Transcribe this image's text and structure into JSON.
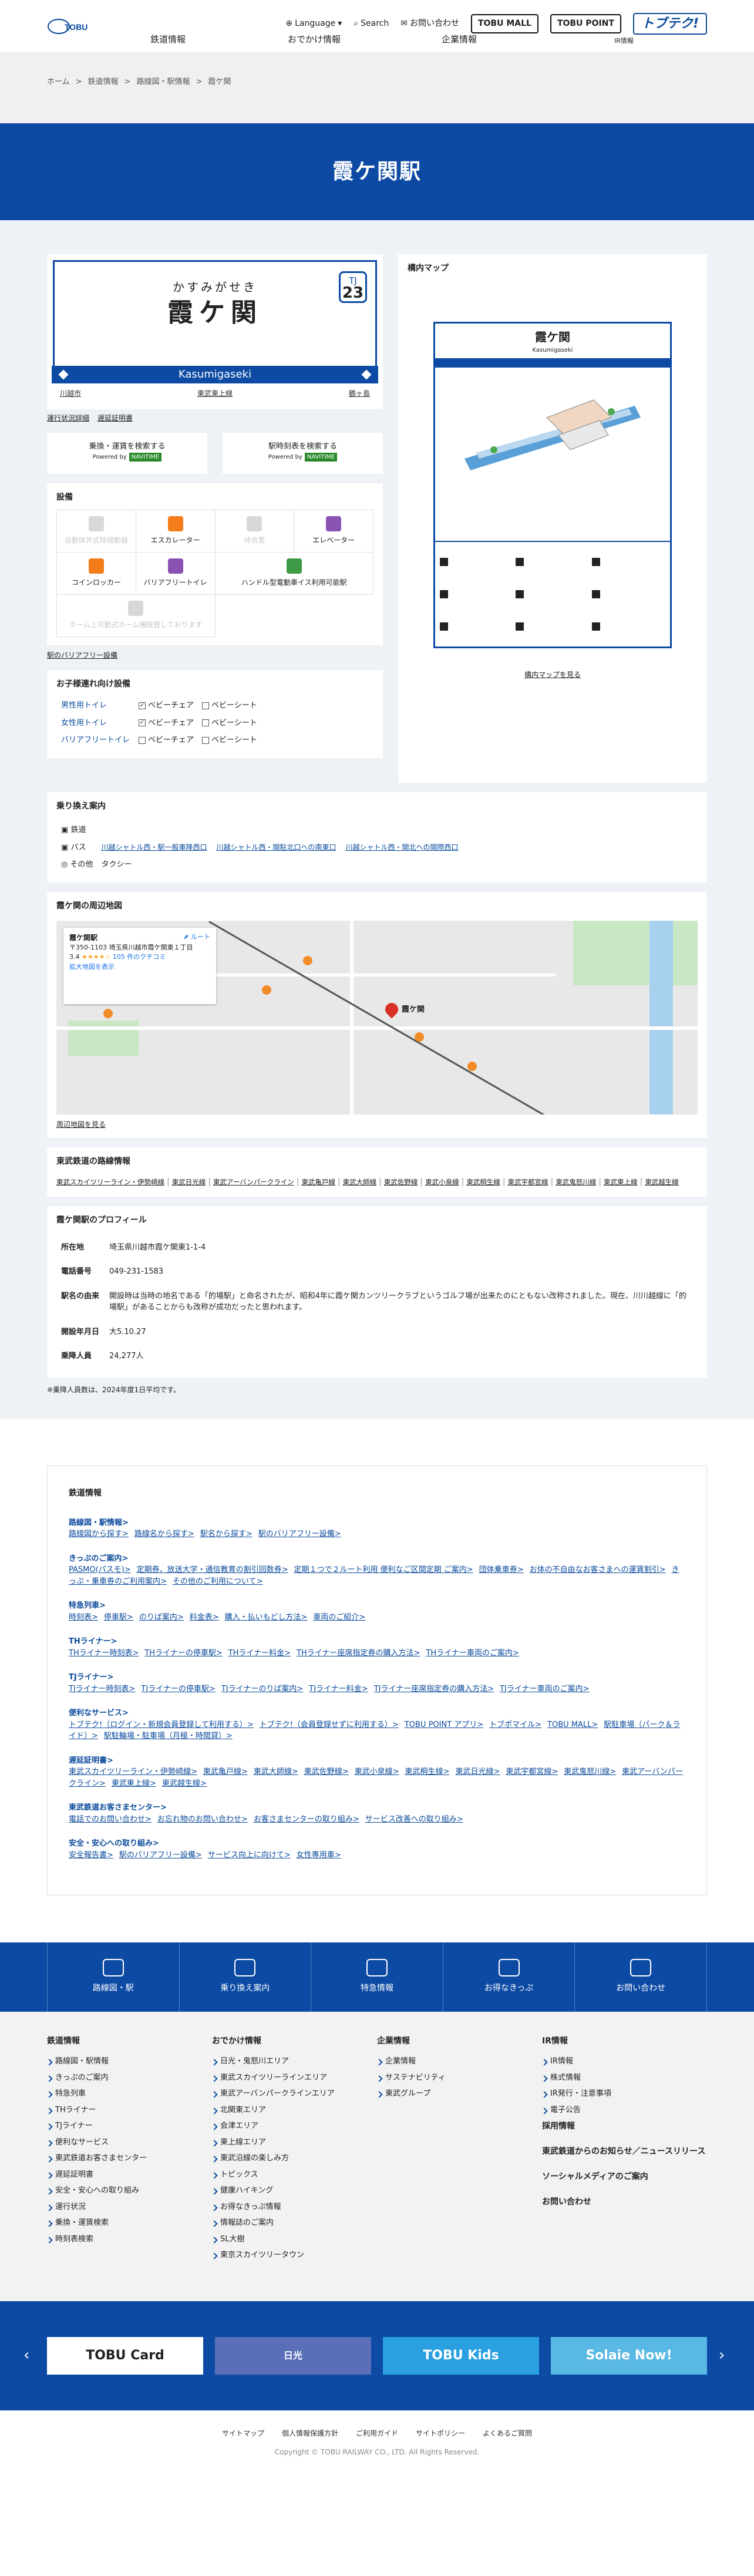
{
  "header": {
    "language": "Language",
    "search": "Search",
    "contact": "お問い合わせ",
    "tobumall": "TOBU MALL",
    "tobupoint": "TOBU POINT",
    "topic": "トブテク!",
    "nav": [
      "鉄道情報",
      "おでかけ情報",
      "企業情報",
      "IR情報"
    ]
  },
  "breadcrumb": [
    "ホーム",
    "鉄道情報",
    "路線図・駅情報",
    "霞ケ関"
  ],
  "hero_title": "霞ケ関駅",
  "sign": {
    "kana": "かすみがせき",
    "kanji": "霞ケ関",
    "roman": "Kasumigaseki",
    "line_code": "TJ",
    "number": "23",
    "prev": "川越市",
    "mid": "東武東上線",
    "next": "鶴ヶ島",
    "link1": "運行状況詳細",
    "link2": "遅延証明書"
  },
  "search_btn1": "乗換・運賃を検索する",
  "search_btn2": "駅時刻表を検索する",
  "powered": "Powered by",
  "navitime": "NAVITIME",
  "facilities": {
    "title": "設備",
    "items": [
      "自動体外式除細動器",
      "エスカレーター",
      "待合室",
      "エレベーター",
      "コインロッカー",
      "バリアフリートイレ",
      "ハンドル型電動車イス利用可能駅"
    ],
    "last": "ホーム上可動式ホーム柵設置しております",
    "link": "駅のバリアフリー設備"
  },
  "child": {
    "title": "お子様連れ向け設備",
    "rows": [
      {
        "name": "男性用トイレ",
        "a": "ベビーチェア",
        "b": "ベビーシート"
      },
      {
        "name": "女性用トイレ",
        "a": "ベビーチェア",
        "b": "ベビーシート"
      },
      {
        "name": "バリアフリートイレ",
        "a": "ベビーチェア",
        "b": "ベビーシート"
      }
    ]
  },
  "floormap": {
    "title": "構内マップ",
    "station": "霞ケ関",
    "roman": "Kasumigaseki",
    "link": "構内マップを見る"
  },
  "transfer": {
    "title": "乗り換え案内",
    "rail": "鉄道",
    "bus": "バス",
    "bus_links": [
      "川越シャトル西・駅一般車降西口",
      "川越シャトル西・関駐北口への南東口",
      "川越シャトル西・関北への関際西口"
    ],
    "other": "その他",
    "taxi": "タクシー"
  },
  "map": {
    "title": "霞ケ関の周辺地図",
    "place": "霞ケ関駅",
    "address": "〒350-1103 埼玉県川越市霞ケ関東１丁目",
    "rating": "3.4",
    "reviews": "105 件のクチコミ",
    "larger": "拡大地図を表示",
    "route": "ルート",
    "pin": "霞ケ関",
    "link": "周辺地図を見る"
  },
  "lines": {
    "title": "東武鉄道の路線情報",
    "items": [
      "東武スカイツリーライン・伊勢崎線",
      "東武日光線",
      "東武アーバンパークライン",
      "東武亀戸線",
      "東武大師線",
      "東武佐野線",
      "東武小泉線",
      "東武桐生線",
      "東武宇都宮線",
      "東武鬼怒川線",
      "東武東上線",
      "東武越生線"
    ]
  },
  "profile": {
    "title": "霞ケ関駅のプロフィール",
    "rows": [
      {
        "k": "所在地",
        "v": "埼玉県川越市霞ケ関東1-1-4"
      },
      {
        "k": "電話番号",
        "v": "049-231-1583"
      },
      {
        "k": "駅名の由来",
        "v": "開設時は当時の地名である「的場駅」と命名されたが、昭和4年に霞ケ関カンツリークラブというゴルフ場が出来たのにともない改称されました。現在、川川越線に「的場駅」があることからも改称が成功だったと思われます。"
      },
      {
        "k": "開設年月日",
        "v": "大5.10.27"
      },
      {
        "k": "乗降人員",
        "v": "24,277人"
      }
    ],
    "note": "※乗降人員数は、2024年度1日平均です。"
  },
  "sitemap": {
    "title": "鉄道情報",
    "groups": [
      {
        "t": "路線図・駅情報>",
        "links": [
          "路線図から探す>",
          "路線名から探す>",
          "駅名から探す>",
          "駅のバリアフリー設備>"
        ]
      },
      {
        "t": "きっぷのご案内>",
        "links": [
          "PASMO(パスモ)>",
          "定期券、放送大学・通信教育の割引回数券>",
          "定期１つで２ルート利用 便利なご区間定期 ご案内>",
          "団体乗車券>",
          "お体の不自由なお客さまへの運賃割引>",
          "きっぷ・乗車券のご利用案内>",
          "その他のご利用について>"
        ]
      },
      {
        "t": "特急列車>",
        "links": [
          "時刻表>",
          "停車駅>",
          "のりば案内>",
          "料金表>",
          "購入・払いもどし方法>",
          "車両のご紹介>"
        ]
      },
      {
        "t": "THライナー>",
        "links": [
          "THライナー時刻表>",
          "THライナーの停車駅>",
          "THライナー料金>",
          "THライナー座席指定券の購入方法>",
          "THライナー車両のご案内>"
        ]
      },
      {
        "t": "TJライナー>",
        "links": [
          "TJライナー時刻表>",
          "TJライナーの停車駅>",
          "TJライナーのりば案内>",
          "TJライナー料金>",
          "TJライナー座席指定券の購入方法>",
          "TJライナー車両のご案内>"
        ]
      },
      {
        "t": "便利なサービス>",
        "links": [
          "トブテク!（ログイン・新規会員登録して利用する）>",
          "トブテク!（会員登録せずに利用する）>",
          "TOBU POINT アプリ>",
          "トブポマイル>",
          "TOBU MALL>",
          "駅駐車場（パーク＆ライド）>",
          "駅駐輪場・駐車場（月極・時間貸）>"
        ]
      },
      {
        "t": "遅延証明書>",
        "links": [
          "東武スカイツリーライン・伊勢崎線>",
          "東武亀戸線>",
          "東武大師線>",
          "東武佐野線>",
          "東武小泉線>",
          "東武桐生線>",
          "東武日光線>",
          "東武宇都宮線>",
          "東武鬼怒川線>",
          "東武アーバンパークライン>",
          "東武東上線>",
          "東武越生線>"
        ]
      },
      {
        "t": "東武鉄道お客さまセンター>",
        "links": [
          "電話でのお問い合わせ>",
          "お忘れ物のお問い合わせ>",
          "お客さまセンターの取り組み>",
          "サービス改善への取り組み>"
        ]
      },
      {
        "t": "安全・安心への取り組み>",
        "links": [
          "安全報告書>",
          "駅のバリアフリー設備>",
          "サービス向上に向けて>",
          "女性専用車>"
        ]
      }
    ]
  },
  "bottomnav": [
    "路線図・駅",
    "乗り換え案内",
    "特急情報",
    "お得なきっぷ",
    "お問い合わせ"
  ],
  "footer": {
    "cols": [
      {
        "h": "鉄道情報",
        "items": [
          "路線図・駅情報",
          "きっぷのご案内",
          "特急列車",
          "THライナー",
          "TJライナー",
          "便利なサービス",
          "東武鉄道お客さまセンター",
          "遅延証明書",
          "安全・安心への取り組み",
          "運行状況",
          "乗換・運賃検索",
          "時刻表検索"
        ]
      },
      {
        "h": "おでかけ情報",
        "items": [
          "日光・鬼怒川エリア",
          "東武スカイツリーラインエリア",
          "東武アーバンパークラインエリア",
          "北関東エリア",
          "会津エリア",
          "東上線エリア",
          "東武沿線の楽しみ方",
          "トピックス",
          "健康ハイキング",
          "お得なきっぷ情報",
          "情報誌のご案内",
          "SL大樹",
          "東京スカイツリータウン"
        ]
      },
      {
        "h": "企業情報",
        "items": [
          "企業情報",
          "サステナビリティ",
          "東武グループ"
        ]
      },
      {
        "h": "IR情報",
        "items": [
          "IR情報",
          "株式情報",
          "IR発行・注意事項",
          "電子公告"
        ],
        "extra": [
          "採用情報",
          "東武鉄道からのお知らせ／ニュースリリース",
          "ソーシャルメディアのご案内",
          "お問い合わせ"
        ]
      }
    ]
  },
  "banners": [
    "TOBU Card",
    "日光",
    "TOBU Kids",
    "Solaie Now!"
  ],
  "bottom_links": [
    "サイトマップ",
    "個人情報保護方針",
    "ご利用ガイド",
    "サイトポリシー",
    "よくあるご質問"
  ],
  "copyright": "Copyright © TOBU RAILWAY CO., LTD. All Rights Reserved."
}
